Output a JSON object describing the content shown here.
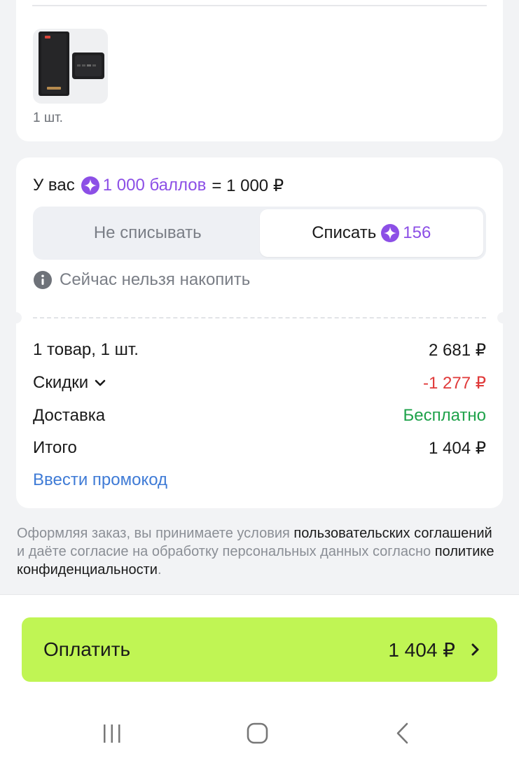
{
  "order_item": {
    "image_icon": "power-bank-product-image",
    "quantity": "1 шт."
  },
  "points": {
    "prefix": "У вас",
    "balance": "1 000 баллов",
    "equals": "= 1 000 ₽",
    "star_icon": "points-star-icon",
    "accent_color": "#8c4fe6",
    "option_keep": "Не списывать",
    "option_spend": "Списать",
    "spend_amount": "156",
    "selected": "Списать",
    "info_text": "Сейчас нельзя накопить"
  },
  "summary": {
    "items_label": "1 товар, 1 шт.",
    "items_value": "2 681 ₽",
    "discounts_label": "Скидки",
    "discounts_value": "-1 277 ₽",
    "delivery_label": "Доставка",
    "delivery_value": "Бесплатно",
    "total_label": "Итого",
    "total_value": "1 404 ₽",
    "promo_link": "Ввести промокод"
  },
  "legal": {
    "part1": "Оформляя заказ, вы принимаете условия ",
    "link1": "пользовательских соглашений",
    "part2": " и даёте согласие на обработку персональных данных согласно ",
    "link2": "политике конфиденциальности",
    "part3": "."
  },
  "pay_button": {
    "label": "Оплатить",
    "amount": "1 404 ₽",
    "color": "#c0f554"
  },
  "system_nav": {
    "recent": "recent-apps-icon",
    "home": "home-icon",
    "back": "back-icon"
  }
}
